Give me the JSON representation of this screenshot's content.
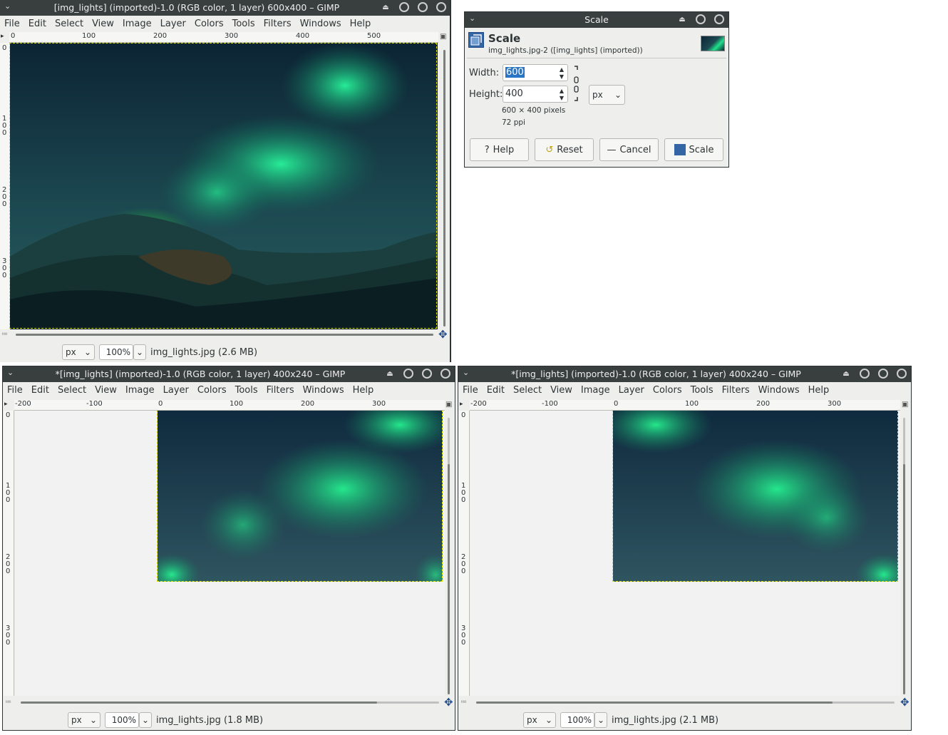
{
  "menu_items": [
    "File",
    "Edit",
    "Select",
    "View",
    "Image",
    "Layer",
    "Colors",
    "Tools",
    "Filters",
    "Windows",
    "Help"
  ],
  "window_top": {
    "title": "[img_lights] (imported)-1.0 (RGB color, 1 layer) 600x400 – GIMP",
    "ruler_h": [
      "0",
      "100",
      "200",
      "300",
      "400",
      "500"
    ],
    "ruler_v": [
      "1\n0\n0",
      "2\n0\n0",
      "3\n0\n0"
    ],
    "ruler_v_zero": "0",
    "unit": "px",
    "zoom": "100%",
    "status": "img_lights.jpg (2.6 MB)"
  },
  "window_bl": {
    "title": "*[img_lights] (imported)-1.0 (RGB color, 1 layer) 400x240 – GIMP",
    "ruler_h": [
      "-200",
      "-100",
      "0",
      "100",
      "200",
      "300"
    ],
    "ruler_v": [
      "1\n0\n0",
      "2\n0\n0",
      "3\n0\n0"
    ],
    "ruler_v_zero": "0",
    "unit": "px",
    "zoom": "100%",
    "status": "img_lights.jpg (1.8 MB)"
  },
  "window_br": {
    "title": "*[img_lights] (imported)-1.0 (RGB color, 1 layer) 400x240 – GIMP",
    "ruler_h": [
      "-200",
      "-100",
      "0",
      "100",
      "200",
      "300"
    ],
    "ruler_v": [
      "1\n0\n0",
      "2\n0\n0",
      "3\n0\n0"
    ],
    "ruler_v_zero": "0",
    "unit": "px",
    "zoom": "100%",
    "status": "img_lights.jpg (2.1 MB)"
  },
  "dialog": {
    "title": "Scale",
    "header": "Scale",
    "subheader": "img_lights.jpg-2 ([img_lights] (imported))",
    "width_label": "Width:",
    "width_value": "600",
    "height_label": "Height:",
    "height_value": "400",
    "unit": "px",
    "size_info": "600 × 400 pixels",
    "ppi_info": "72 ppi",
    "help_label": "Help",
    "reset_label": "Reset",
    "cancel_label": "Cancel",
    "scale_label": "Scale"
  },
  "colors": {
    "titlebar": "#393f3f",
    "window_bg": "#eeeeec",
    "selection_highlight": "#2a76c6",
    "aurora_green": "#1fe08a",
    "sky_dark": "#0f2a3a"
  }
}
